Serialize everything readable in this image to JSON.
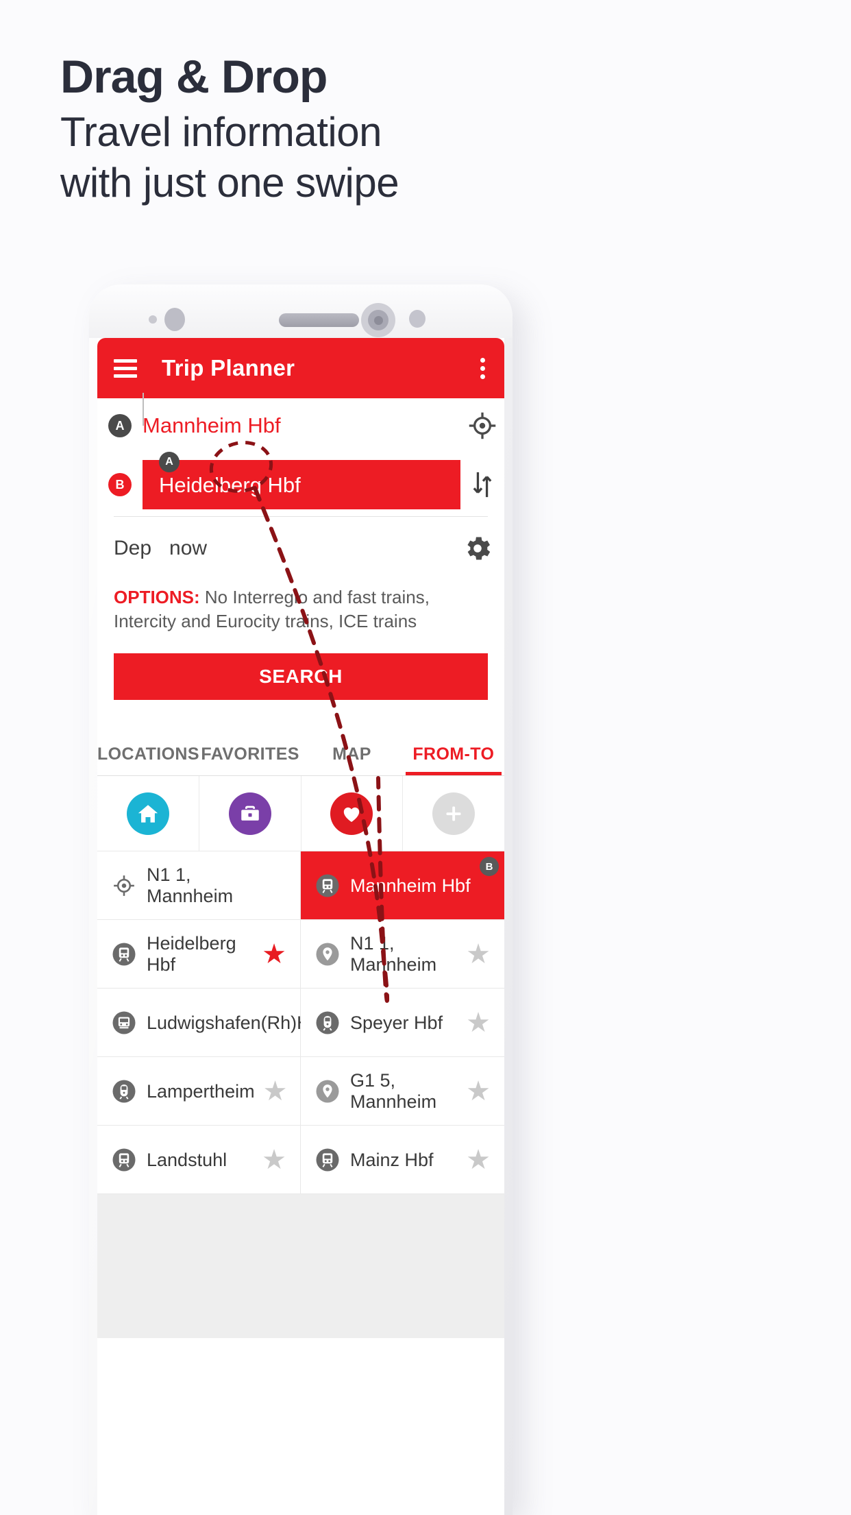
{
  "headline": {
    "title": "Drag & Drop",
    "subtitle_line1": "Travel information",
    "subtitle_line2": "with just one swipe"
  },
  "colors": {
    "brand_red": "#ED1C24",
    "badge_dark": "#4A4A4A",
    "home_cyan": "#1BB4D4",
    "work_purple": "#7A3FA8",
    "fav_red": "#E01B22",
    "add_grey": "#DCDCDC",
    "headline_dark": "#2B2E3B"
  },
  "appbar": {
    "title": "Trip Planner",
    "menu_icon": "hamburger-icon",
    "overflow_icon": "kebab-menu-icon"
  },
  "form": {
    "from_badge": "A",
    "from_value": "Mannheim Hbf",
    "to_badge": "B",
    "to_value": "Heidelberg Hbf",
    "drag_badge": "A",
    "gps_icon": "my-location-icon",
    "swap_icon": "swap-vertical-icon",
    "dep_label": "Dep",
    "dep_value": "now",
    "settings_icon": "gear-icon",
    "options_label": "OPTIONS:",
    "options_text": "No Interregio and fast trains, Intercity and Eurocity trains, ICE trains",
    "search_label": "SEARCH"
  },
  "tabs": [
    {
      "label": "LOCATIONS",
      "active": false
    },
    {
      "label": "FAVORITES",
      "active": false
    },
    {
      "label": "MAP",
      "active": false
    },
    {
      "label": "FROM-TO",
      "active": true
    }
  ],
  "quick_access": [
    {
      "name": "home",
      "icon": "home-icon",
      "color": "#1BB4D4"
    },
    {
      "name": "work",
      "icon": "briefcase-icon",
      "color": "#7A3FA8"
    },
    {
      "name": "favorite",
      "icon": "heart-icon",
      "color": "#E01B22"
    },
    {
      "name": "add",
      "icon": "plus-icon",
      "color": "#DCDCDC"
    }
  ],
  "left_list": [
    {
      "icon": "my-location-icon",
      "name": "N1 1, Mannheim",
      "star": null,
      "selected": false
    },
    {
      "icon": "train-icon",
      "name": "Heidelberg Hbf",
      "star": "filled",
      "selected": false
    },
    {
      "icon": "tram-icon",
      "name": "Ludwigshafen(Rh)Hbf",
      "star": "empty",
      "selected": false
    },
    {
      "icon": "subway-icon",
      "name": "Lampertheim",
      "star": "empty",
      "selected": false
    },
    {
      "icon": "train-icon",
      "name": "Landstuhl",
      "star": "empty",
      "selected": false
    }
  ],
  "right_list": [
    {
      "icon": "train-icon",
      "name": "Mannheim Hbf",
      "star": null,
      "selected": true,
      "badge": "B"
    },
    {
      "icon": "place-pin-icon",
      "name": "N1 1, Mannheim",
      "star": "empty",
      "selected": false
    },
    {
      "icon": "subway-icon",
      "name": "Speyer Hbf",
      "star": "empty",
      "selected": false
    },
    {
      "icon": "place-pin-icon",
      "name": "G1 5, Mannheim",
      "star": "empty",
      "selected": false
    },
    {
      "icon": "train-icon",
      "name": "Mainz Hbf",
      "star": "empty",
      "selected": false
    }
  ]
}
